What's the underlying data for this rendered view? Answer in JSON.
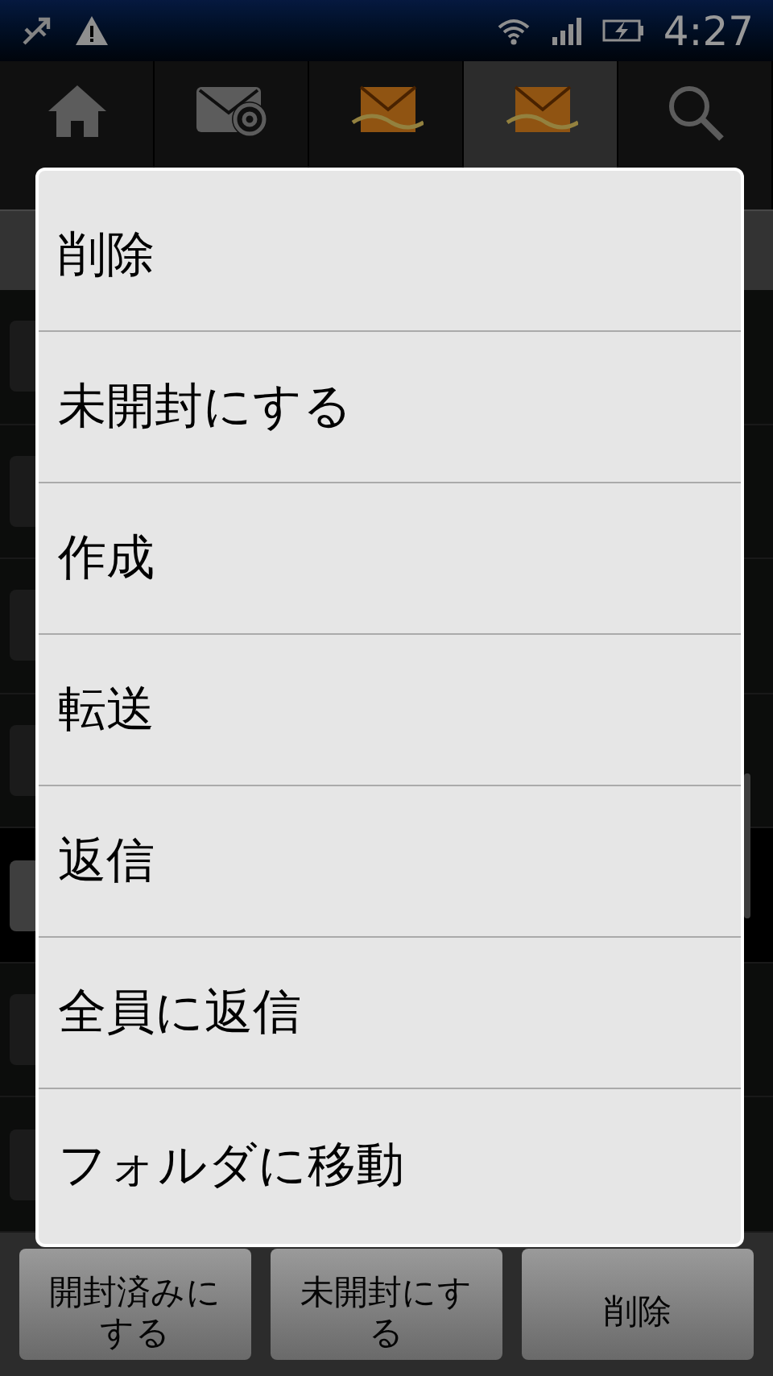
{
  "status_bar": {
    "time": "4:27"
  },
  "tabs": [
    {
      "kind": "home",
      "selected": false
    },
    {
      "kind": "all",
      "selected": false
    },
    {
      "kind": "mailbox",
      "selected": false
    },
    {
      "kind": "mailbox",
      "selected": true
    },
    {
      "kind": "search",
      "selected": false
    }
  ],
  "message_rows": [
    {
      "checked": false
    },
    {
      "checked": false
    },
    {
      "checked": false
    },
    {
      "checked": false
    },
    {
      "checked": true
    },
    {
      "checked": false
    },
    {
      "checked": false
    }
  ],
  "context_menu": {
    "items": [
      "削除",
      "未開封にする",
      "作成",
      "転送",
      "返信",
      "全員に返信",
      "フォルダに移動"
    ]
  },
  "bottom_buttons": [
    "開封済みにする",
    "未開封にする",
    "削除"
  ]
}
